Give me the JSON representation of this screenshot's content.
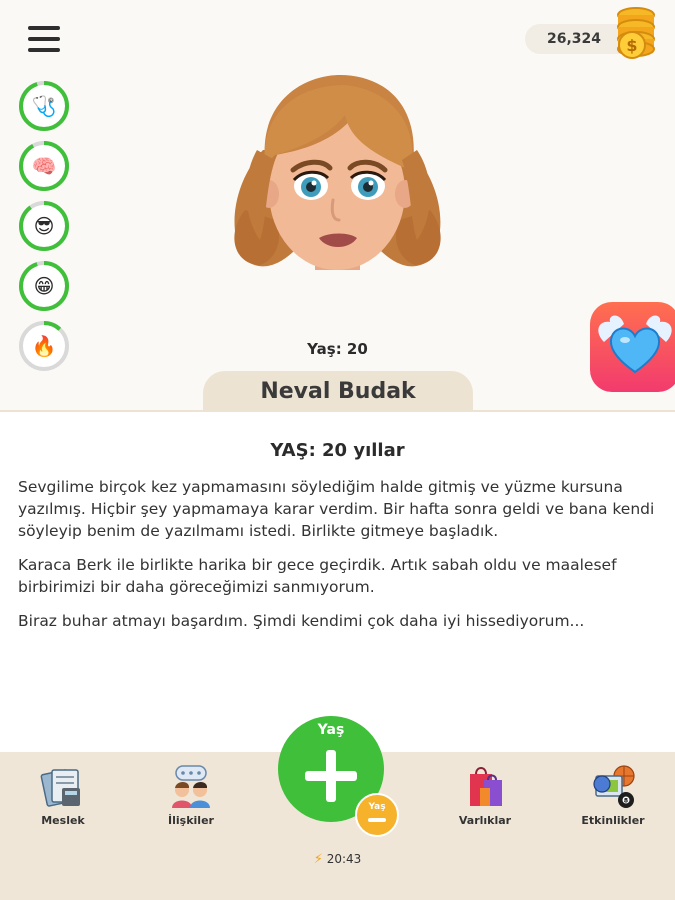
{
  "header": {
    "money": "26,324",
    "menu_icon": "hamburger-menu-icon",
    "coins_icon": "coin-stack-icon"
  },
  "stats": [
    {
      "name": "health",
      "icon": "first-aid-kit-icon",
      "glyph": "🩺",
      "level": 0.95,
      "color": "#3fbf3a"
    },
    {
      "name": "smarts",
      "icon": "brain-icon",
      "glyph": "🧠",
      "level": 0.92,
      "color": "#3fbf3a"
    },
    {
      "name": "looks",
      "icon": "cool-sunglasses-face-icon",
      "glyph": "😎",
      "level": 0.9,
      "color": "#3fbf3a"
    },
    {
      "name": "happiness",
      "icon": "grinning-face-icon",
      "glyph": "😁",
      "level": 0.95,
      "color": "#3fbf3a"
    },
    {
      "name": "karma",
      "icon": "fire-icon",
      "glyph": "🔥",
      "level": 0.12,
      "color": "#3fbf3a"
    }
  ],
  "character": {
    "age_label": "Yaş: 20",
    "name": "Neval Budak"
  },
  "log": {
    "title": "YAŞ: 20 yıllar",
    "entries": [
      "Sevgilime birçok kez yapmamasını söylediğim halde gitmiş ve yüzme kursuna yazılmış. Hiçbir şey yapmamaya karar verdim. Bir hafta sonra geldi ve bana kendi söyleyip benim de yazılmamı istedi. Birlikte gitmeye başladık.",
      "Karaca Berk ile birlikte harika bir gece geçirdik. Artık sabah oldu ve maalesef birbirimizi bir daha göreceğimizi sanmıyorum.",
      "Biraz buhar atmayı başardım. Şimdi kendimi çok daha iyi hissediyorum..."
    ]
  },
  "nav": {
    "career": {
      "label": "Meslek",
      "icon": "job-documents-icon"
    },
    "relationships": {
      "label": "İlişkiler",
      "icon": "people-chat-icon"
    },
    "assets": {
      "label": "Varlıklar",
      "icon": "shopping-bags-icon"
    },
    "activities": {
      "label": "Etkinlikler",
      "icon": "activities-balls-icon"
    }
  },
  "age_button": {
    "label": "Yaş",
    "icon": "plus-icon",
    "color": "#3fbf3a"
  },
  "age_minus": {
    "label": "Yaş",
    "icon": "minus-icon",
    "color": "#f6b22b"
  },
  "timer": {
    "value": "20:43",
    "icon": "lightning-bolt-icon"
  },
  "love_button": {
    "icon": "winged-heart-icon"
  }
}
